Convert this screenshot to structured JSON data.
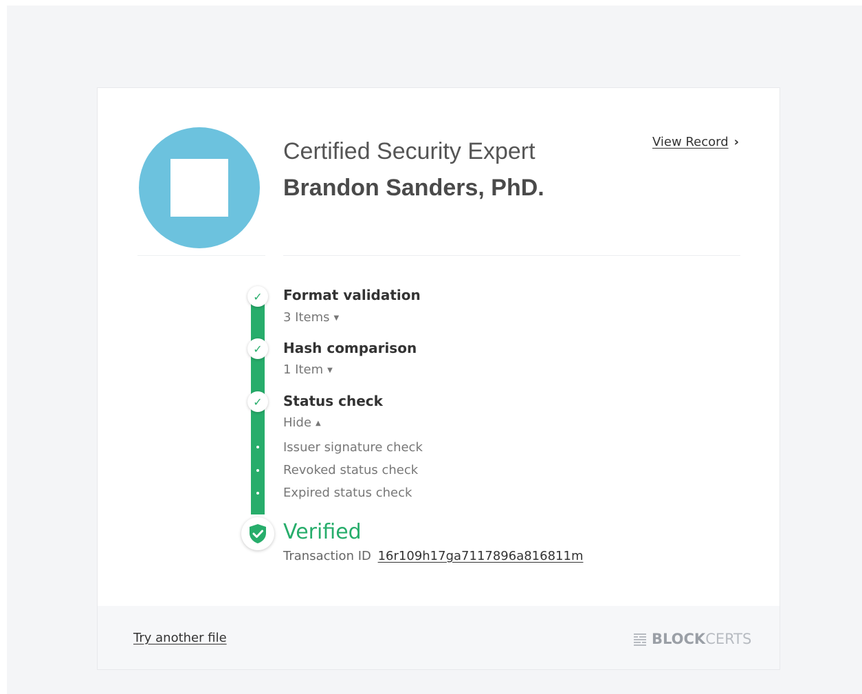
{
  "certificate": {
    "title": "Certified Security Expert",
    "recipient": "Brandon Sanders, PhD.",
    "view_record_label": "View Record"
  },
  "verification": {
    "steps": [
      {
        "label": "Format validation",
        "toggle": "3 Items"
      },
      {
        "label": "Hash comparison",
        "toggle": "1 Item"
      },
      {
        "label": "Status check",
        "toggle": "Hide"
      }
    ],
    "sub_steps": [
      "Issuer signature check",
      "Revoked status check",
      "Expired status check"
    ],
    "result": "Verified",
    "transaction_label": "Transaction ID",
    "transaction_id": "16r109h17ga7117896a816811m"
  },
  "footer": {
    "try_another_label": "Try another file",
    "brand_bold": "BLOCK",
    "brand_light": "CERTS"
  },
  "colors": {
    "accent_green": "#27ad6b",
    "avatar_blue": "#6cc2de",
    "page_bg": "#f4f5f7"
  }
}
